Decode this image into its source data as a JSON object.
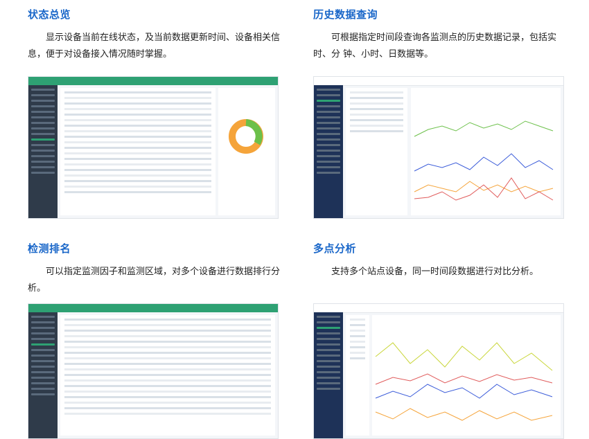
{
  "sections": [
    {
      "title": "状态总览",
      "desc": "显示设备当前在线状态，及当前数据更新时间、设备相关信息，便于对设备接入情况随时掌握。",
      "screenshot_icon": "status-overview-screenshot"
    },
    {
      "title": "历史数据查询",
      "desc": "可根据指定时间段查询各监测点的历史数据记录，包括实时、分 钟、小时、日数据等。",
      "screenshot_icon": "history-query-screenshot"
    },
    {
      "title": "检测排名",
      "desc": "可以指定监测因子和监测区域，对多个设备进行数据排行分析。",
      "screenshot_icon": "ranking-screenshot"
    },
    {
      "title": "多点分析",
      "desc": "支持多个站点设备，同一时间段数据进行对比分析。",
      "screenshot_icon": "multipoint-screenshot"
    }
  ],
  "colors": {
    "title": "#1a67c9",
    "app_green": "#2ea173",
    "app_dark": "#2f3b4a",
    "app_navy": "#1e3258"
  }
}
